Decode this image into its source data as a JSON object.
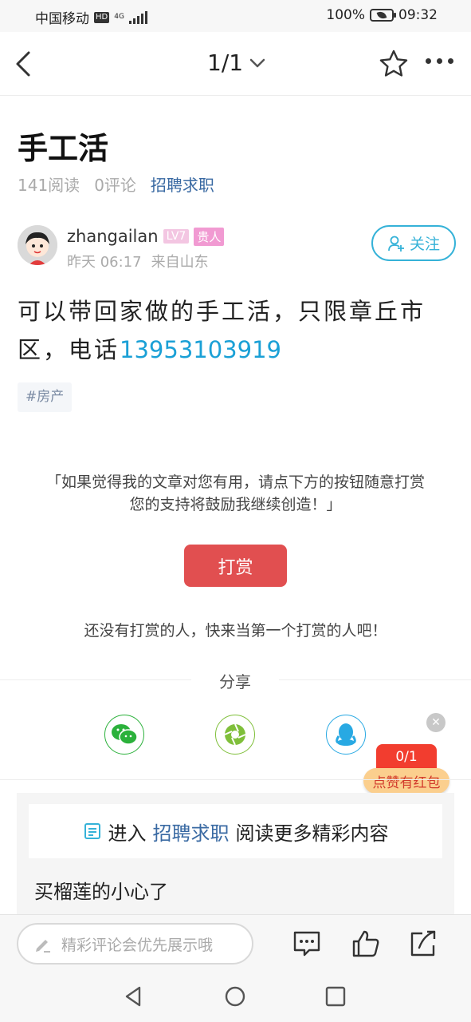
{
  "status_bar": {
    "carrier": "中国移动",
    "hd_badge": "HD",
    "network": "4G",
    "battery": "100%",
    "time": "09:32"
  },
  "nav": {
    "pager": "1/1",
    "icons": [
      "back-arrow-icon",
      "chevron-down-icon",
      "star-icon",
      "more-icon"
    ]
  },
  "article": {
    "title": "手工活",
    "reads": "141阅读",
    "comments": "0评论",
    "category": "招聘求职",
    "author": {
      "name": "zhangailan",
      "level": "LV7",
      "badge": "贵人",
      "time": "昨天 06:17",
      "location": "来自山东",
      "follow_label": "关注"
    },
    "body_prefix": "可以带回家做的手工活，只限章丘市区，电话",
    "phone": "13953103919",
    "tag": "#房产"
  },
  "reward": {
    "line1": "「如果觉得我的文章对您有用，请点下方的按钮随意打赏",
    "line2": "您的支持将鼓励我继续创造！」",
    "button": "打赏",
    "none_text": "还没有打赏的人，快来当第一个打赏的人吧！"
  },
  "share": {
    "label": "分享",
    "targets": [
      "wechat-icon",
      "moments-icon",
      "qq-icon"
    ]
  },
  "red_packet": {
    "count": "0/1",
    "label": "点赞有红包"
  },
  "more": {
    "prefix": "进入",
    "category": "招聘求职",
    "suffix": "阅读更多精彩内容",
    "related_title": "买榴莲的小心了"
  },
  "comment_bar": {
    "placeholder": "精彩评论会优先展示哦"
  },
  "colors": {
    "accent_blue": "#35b2d8",
    "phone_blue": "#1aa0d6",
    "category_blue": "#3a6aa3",
    "reward_red": "#e14f50"
  }
}
